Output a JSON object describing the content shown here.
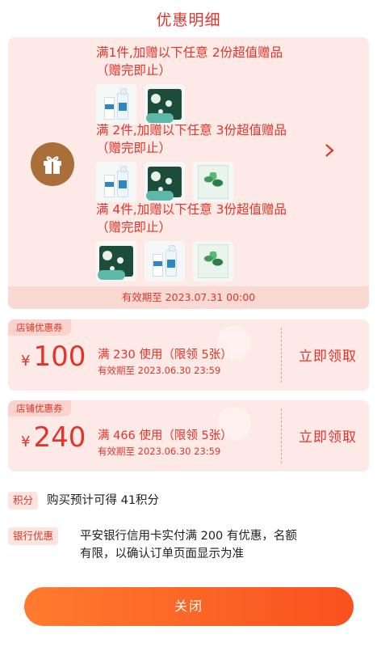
{
  "header": {
    "title": "优惠明细"
  },
  "gift_promo": {
    "icon": "gift-icon",
    "arrow_icon": "chevron-right-icon",
    "tiers": [
      {
        "text": "满1件,加赠以下任意 2份超值赠品（赠完即止）",
        "products": [
          "eye-drops",
          "eye-mask-pack"
        ]
      },
      {
        "text": "满 2件,加赠以下任意 3份超值赠品（赠完即止）",
        "products": [
          "eye-drops",
          "eye-mask-pack",
          "herbal-patch-box"
        ]
      },
      {
        "text": "满 4件,加赠以下任意 3份超值赠品（赠完即止）",
        "products": [
          "eye-mask-pack",
          "eye-drops",
          "herbal-patch-box"
        ]
      }
    ],
    "validity": "有效期至 2023.07.31 00:00"
  },
  "coupons": [
    {
      "tag": "店铺优惠券",
      "currency": "¥",
      "amount": "100",
      "condition": "满 230 使用（限领 5张）",
      "expiry": "有效期至 2023.06.30 23:59",
      "button": "立即领取"
    },
    {
      "tag": "店铺优惠券",
      "currency": "¥",
      "amount": "240",
      "condition": "满 466 使用（限领 5张）",
      "expiry": "有效期至 2023.06.30 23:59",
      "button": "立即领取"
    }
  ],
  "points": {
    "label": "积分",
    "text": "购买预计可得 41积分"
  },
  "bank": {
    "label": "银行优惠",
    "line1": "平安银行信用卡实付满 200 有优惠，名额",
    "line2": "有限，以确认订单页面显示为准"
  },
  "footer": {
    "close_label": "关闭"
  },
  "colors": {
    "accent": "#e2342b",
    "card_bg": "#fde9e6",
    "gift_icon_bg": "#a96e3a",
    "button_start": "#ff7b2e",
    "button_end": "#f9511f"
  }
}
